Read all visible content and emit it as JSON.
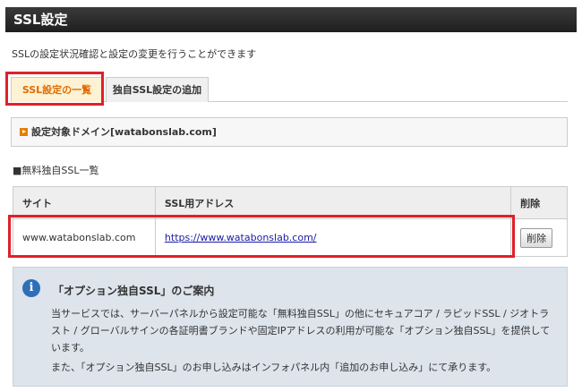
{
  "header": {
    "title": "SSL設定"
  },
  "intro": "SSLの設定状況確認と設定の変更を行うことができます",
  "tabs": [
    {
      "label": "SSL設定の一覧",
      "active": true
    },
    {
      "label": "独自SSL設定の追加",
      "active": false
    }
  ],
  "domain_box": {
    "label": "設定対象ドメイン[watabonslab.com]"
  },
  "section": {
    "label": "■無料独自SSL一覧"
  },
  "table": {
    "headers": [
      "サイト",
      "SSL用アドレス",
      "削除"
    ],
    "rows": [
      {
        "site": "www.watabonslab.com",
        "address": "https://www.watabonslab.com/",
        "delete_label": "削除"
      }
    ]
  },
  "info": {
    "title": "「オプション独自SSL」のご案内",
    "text": "当サービスでは、サーバーパネルから設定可能な「無料独自SSL」の他にセキュアコア / ラピッドSSL / ジオトラスト / グローバルサインの各証明書ブランドや固定IPアドレスの利用が可能な「オプション独自SSL」を提供しています。",
    "text2": "また、「オプション独自SSL」のお申し込みはインフォパネル内「追加のお申し込み」にて承ります。"
  },
  "colors": {
    "accent": "#e06c00",
    "highlight": "#e0202a",
    "link": "#1a1aa6",
    "info_icon": "#2e6fb8"
  }
}
